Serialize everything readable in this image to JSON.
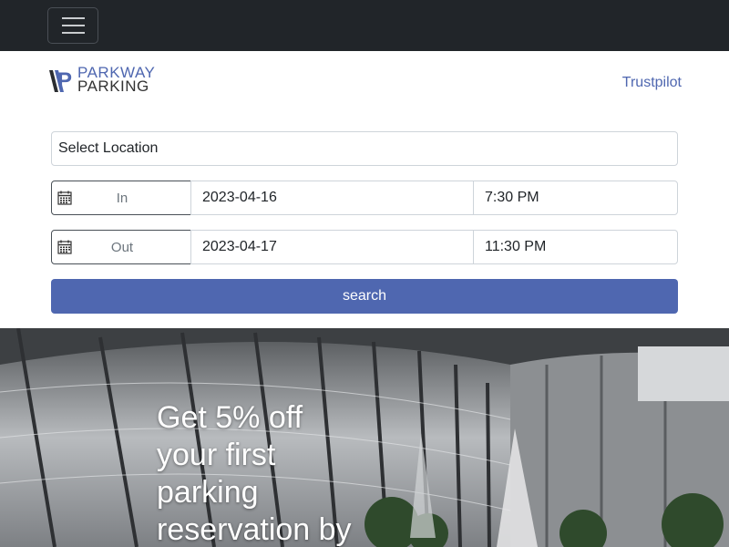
{
  "header": {
    "menu_icon": "hamburger-menu-icon"
  },
  "brand": {
    "logo_word_1": "PARKWAY",
    "logo_word_2": "PARKING",
    "logo_letter": "P",
    "trustpilot_link": "Trustpilot",
    "accent_color": "#4f67b0"
  },
  "booking": {
    "location_select": "Select Location",
    "in": {
      "label": "In",
      "date": "2023-04-16",
      "time": "7:30 PM",
      "icon": "calendar-icon"
    },
    "out": {
      "label": "Out",
      "date": "2023-04-17",
      "time": "11:30 PM",
      "icon": "calendar-icon"
    },
    "search_label": "search"
  },
  "hero": {
    "headline": "Get 5% off your first parking reservation by"
  }
}
